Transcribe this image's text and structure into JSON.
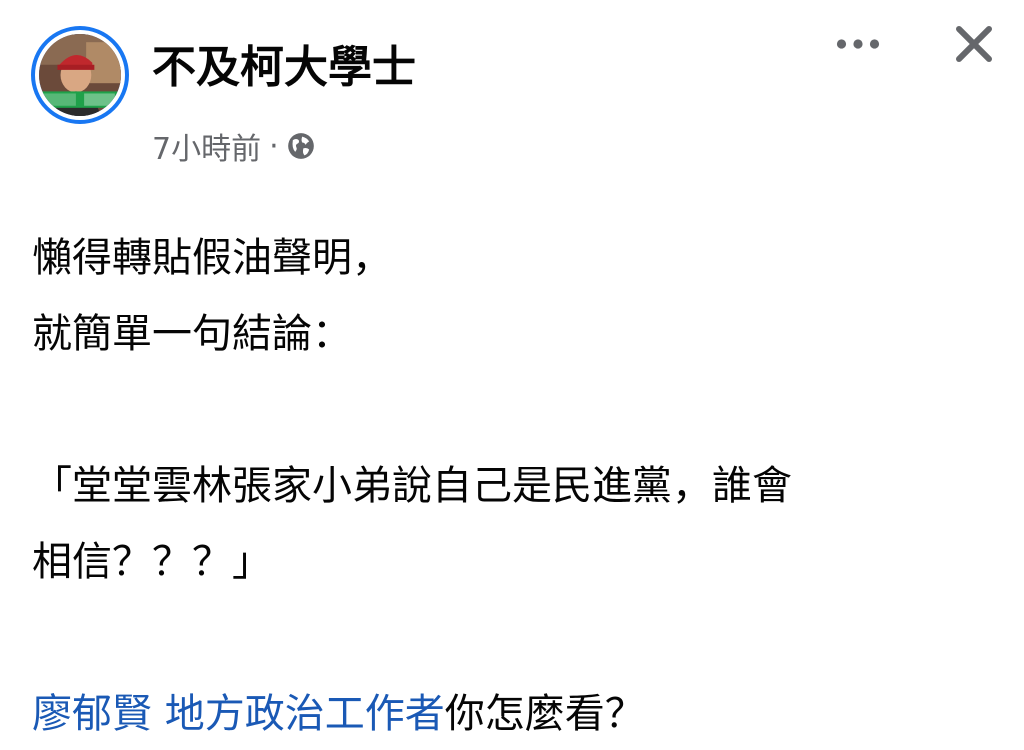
{
  "post": {
    "author": "不及柯大學士",
    "time": "7小時前",
    "separator": "·",
    "privacy_icon": "globe-icon",
    "more_icon": "more-dots-icon",
    "close_icon": "close-icon",
    "avatar_icon": "avatar",
    "lines": [
      "懶得轉貼假油聲明，",
      "就簡單一句結論：",
      "「堂堂雲林張家小弟說自己是民進黨，誰會",
      "相信？？？」"
    ],
    "mention_1": "廖郁賢",
    "mention_2": "地方政治工作者",
    "mention_suffix": "你怎麼看？"
  },
  "colors": {
    "accent": "#1877f2",
    "mention": "#1a59b5",
    "secondary_text": "#65676b",
    "avatar_banner": "#1fa14a"
  }
}
